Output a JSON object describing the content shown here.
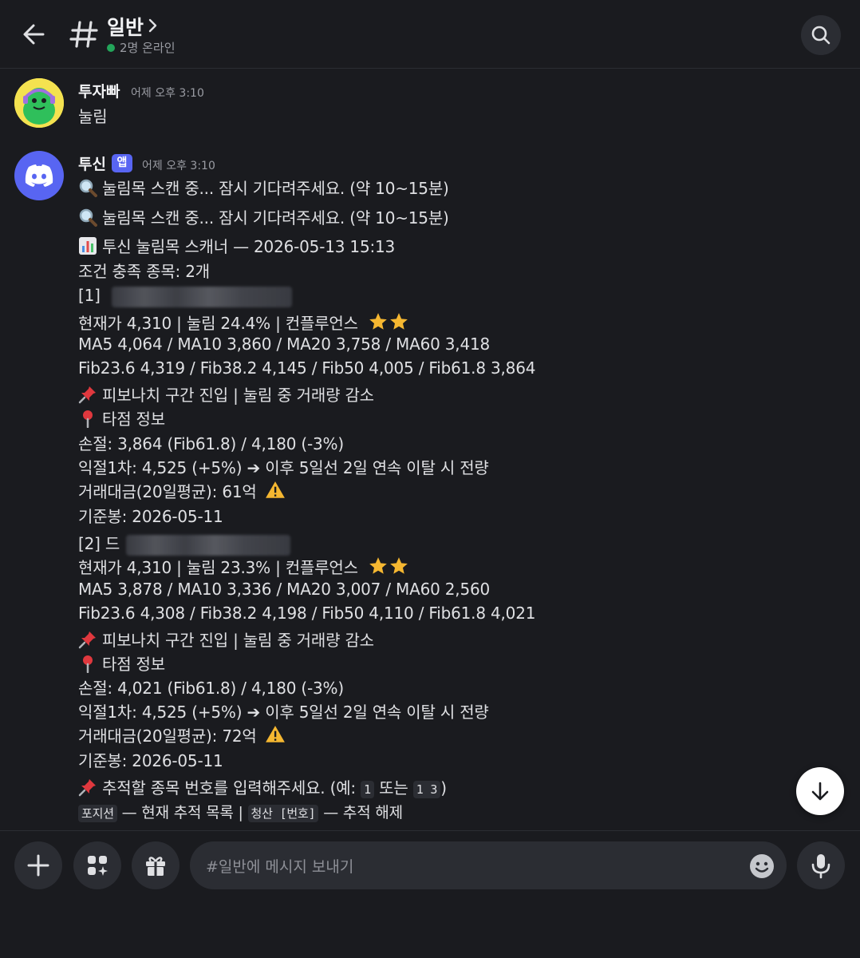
{
  "header": {
    "channel_name": "일반",
    "online_status": "2명 온라인"
  },
  "messages": [
    {
      "username": "투자빠",
      "timestamp": "어제 오후 3:10",
      "text": "눌림"
    },
    {
      "username": "투신",
      "badge": "앱",
      "timestamp": "어제 오후 3:10",
      "lines": {
        "scan1": "눌림목 스캔 중... 잠시 기다려주세요. (약 10~15분)",
        "scan2": "눌림목 스캔 중... 잠시 기다려주세요. (약 10~15분)",
        "scanner_title": "투신 눌림목 스캐너 — 2026-05-13 15:13",
        "count": "조건 충족 종목: 2개",
        "item1_prefix": "[1]",
        "item1_price": "현재가 4,310 | 눌림 24.4% | 컨플루언스",
        "item1_ma": "MA5 4,064  /  MA10 3,860  /  MA20 3,758  /  MA60 3,418",
        "item1_fib": "Fib23.6 4,319  /  Fib38.2 4,145  /  Fib50 4,005  /  Fib61.8 3,864",
        "item1_zone": "피보나치 구간 진입 | 눌림 중 거래량 감소",
        "item1_entry": "타점 정보",
        "item1_stop": "손절: 3,864 (Fib61.8) / 4,180 (-3%)",
        "item1_tp": "익절1차: 4,525 (+5%) ➔ 이후 5일선 2일 연속 이탈 시 전량",
        "item1_volume": "거래대금(20일평균): 61억",
        "item1_base": "기준봉: 2026-05-11",
        "item2_prefix": "[2] 드",
        "item2_price": "현재가 4,310 | 눌림 23.3% | 컨플루언스",
        "item2_ma": "MA5 3,878  /  MA10 3,336  /  MA20 3,007  /  MA60 2,560",
        "item2_fib": "Fib23.6 4,308  /  Fib38.2 4,198  /  Fib50 4,110  /  Fib61.8 4,021",
        "item2_zone": "피보나치 구간 진입 | 눌림 중 거래량 감소",
        "item2_entry": "타점 정보",
        "item2_stop": "손절: 4,021 (Fib61.8) / 4,180 (-3%)",
        "item2_tp": "익절1차: 4,525 (+5%) ➔ 이후 5일선 2일 연속 이탈 시 전량",
        "item2_volume": "거래대금(20일평균): 72억",
        "item2_base": "기준봉: 2026-05-11",
        "prompt_prefix": "추적할 종목 번호를 입력해주세요. (예:",
        "prompt_code1": "1",
        "prompt_mid": "또는",
        "prompt_code2": "1 3",
        "prompt_suffix": ")",
        "footer_code1": "포지션",
        "footer_text1": "— 현재 추적 목록 |",
        "footer_code2": "청산 [번호]",
        "footer_text2": "— 추적 해제"
      }
    }
  ],
  "composer": {
    "placeholder": "#일반에 메시지 보내기"
  },
  "icons": {
    "back": "arrow-left-icon",
    "channel": "hash-icon",
    "search": "search-icon",
    "add": "plus-icon",
    "apps": "sparkle-apps-icon",
    "gift": "gift-icon",
    "emoji": "smile-icon",
    "mic": "microphone-icon",
    "jump": "arrow-down-icon"
  },
  "colors": {
    "background": "#1a1b1f",
    "online": "#23a55a",
    "brand": "#5865f2"
  }
}
